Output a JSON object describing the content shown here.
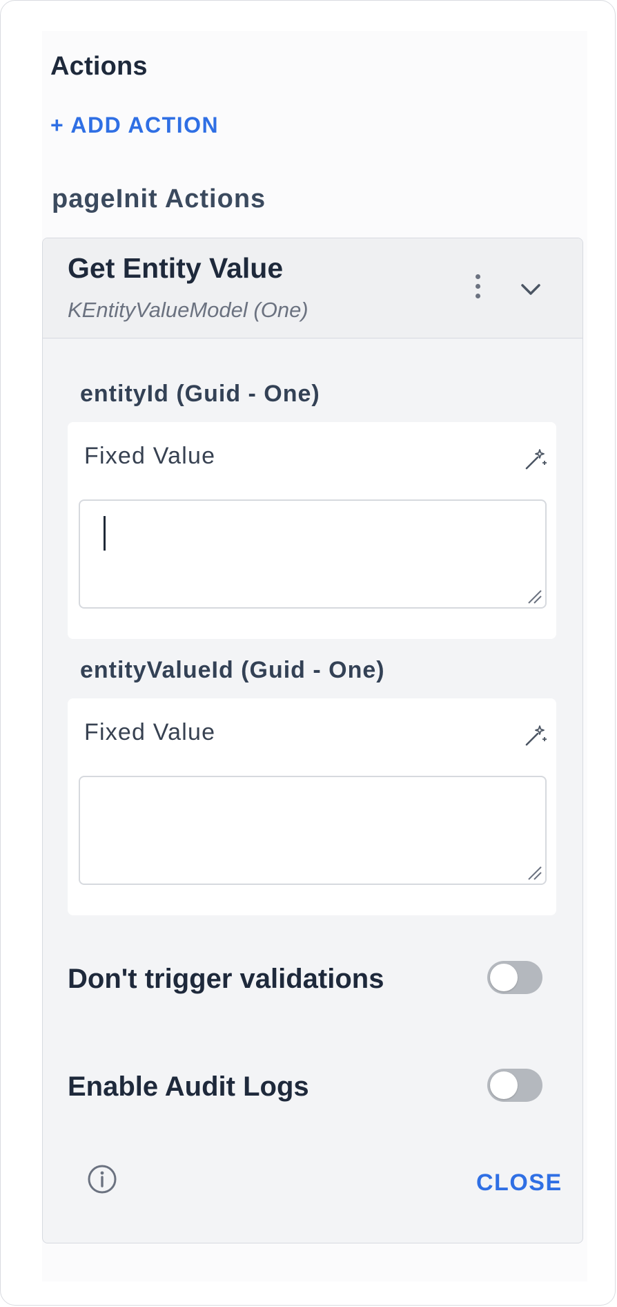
{
  "panel": {
    "title": "Actions",
    "add_action_label": "+ ADD ACTION",
    "section_title": "pageInit Actions"
  },
  "action": {
    "title": "Get Entity Value",
    "subtitle": "KEntityValueModel (One)",
    "icons": {
      "menu": "kebab-icon",
      "expand": "chevron-down-icon"
    }
  },
  "params": [
    {
      "label": "entityId (Guid - One)",
      "mode": "Fixed Value",
      "value": "",
      "icon": "magic-wand-icon"
    },
    {
      "label": "entityValueId (Guid - One)",
      "mode": "Fixed Value",
      "value": "",
      "icon": "magic-wand-icon"
    }
  ],
  "toggles": [
    {
      "label": "Don't trigger validations",
      "on": false
    },
    {
      "label": "Enable Audit Logs",
      "on": false
    }
  ],
  "footer": {
    "info_icon": "info-icon",
    "close_label": "CLOSE"
  },
  "colors": {
    "accent": "#2f6fe4",
    "toggle_off": "#b4b8be",
    "card_bg": "#f3f4f6"
  }
}
